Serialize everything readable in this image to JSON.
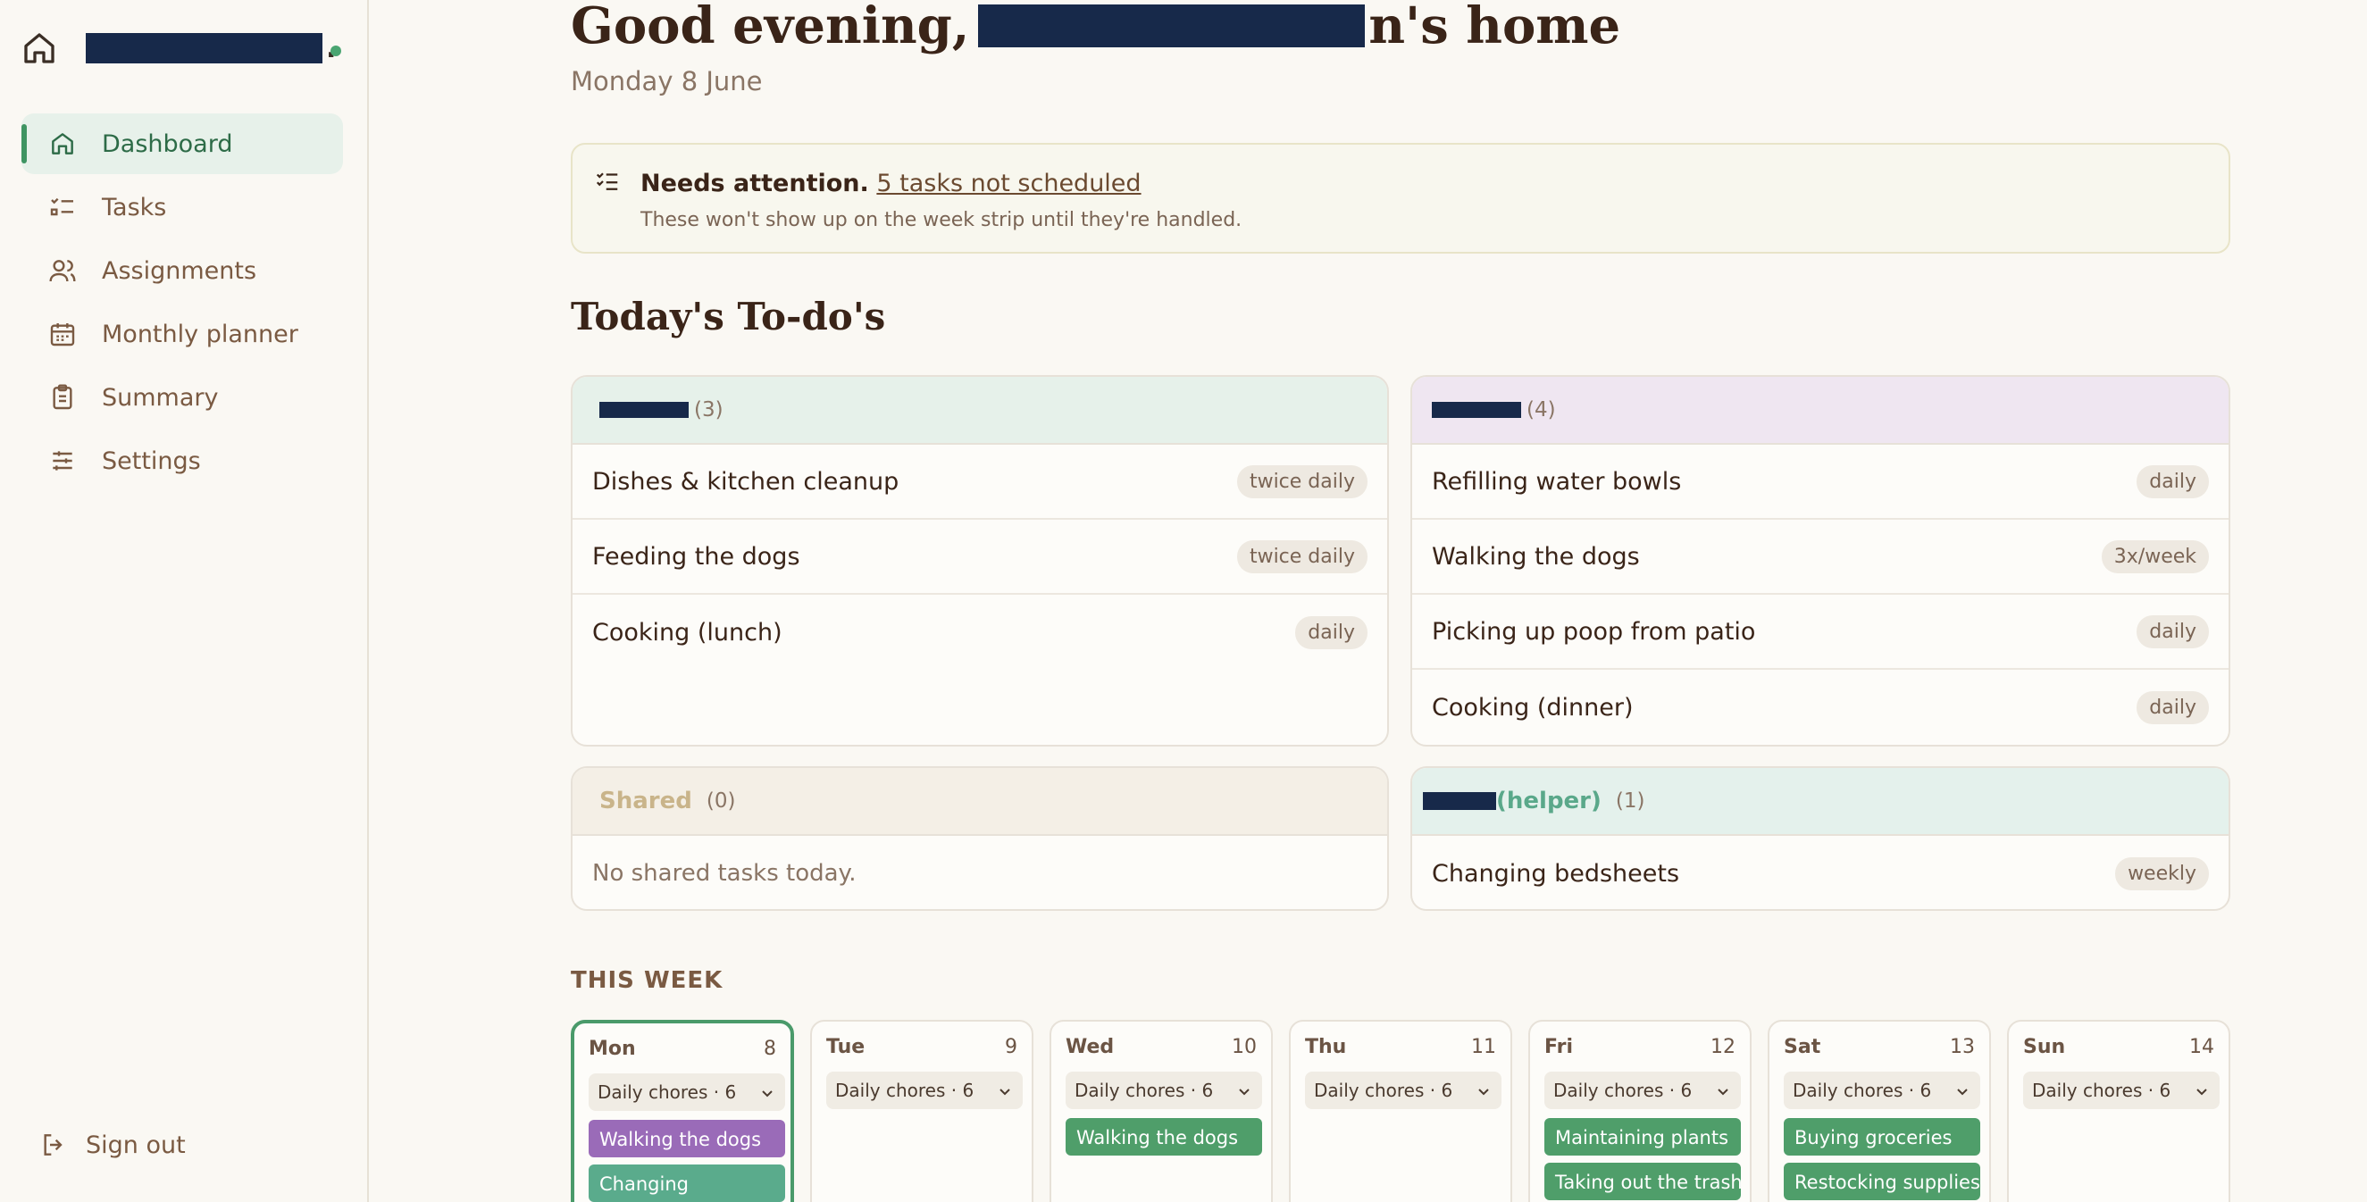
{
  "sidebar": {
    "brand_suffix": ".",
    "nav": [
      {
        "label": "Dashboard",
        "icon": "home-icon",
        "active": true
      },
      {
        "label": "Tasks",
        "icon": "list-check-icon"
      },
      {
        "label": "Assignments",
        "icon": "users-icon"
      },
      {
        "label": "Monthly planner",
        "icon": "calendar-icon"
      },
      {
        "label": "Summary",
        "icon": "clipboard-icon"
      },
      {
        "label": "Settings",
        "icon": "sliders-icon"
      }
    ],
    "sign_out": "Sign out"
  },
  "header": {
    "greeting_prefix": "Good evening,",
    "greeting_suffix": "n's home",
    "date": "Monday 8 June"
  },
  "attention": {
    "title": "Needs attention.",
    "link": "5 tasks not scheduled",
    "note": "These won't show up on the week strip until they're handled."
  },
  "todos": {
    "title": "Today's To-do's",
    "cards": [
      {
        "count": "(3)",
        "color": "#e6f1ea",
        "rows": [
          {
            "task": "Dishes & kitchen cleanup",
            "freq": "twice daily"
          },
          {
            "task": "Feeding the dogs",
            "freq": "twice daily"
          },
          {
            "task": "Cooking (lunch)",
            "freq": "daily"
          }
        ]
      },
      {
        "count": "(4)",
        "color": "#efe6f1",
        "rows": [
          {
            "task": "Refilling water bowls",
            "freq": "daily"
          },
          {
            "task": "Walking the dogs",
            "freq": "3x/week"
          },
          {
            "task": "Picking up poop from patio",
            "freq": "daily"
          },
          {
            "task": "Cooking (dinner)",
            "freq": "daily"
          }
        ]
      },
      {
        "name": "Shared",
        "count": "(0)",
        "color": "#f4efe6",
        "empty": "No shared tasks today."
      },
      {
        "name": "(helper)",
        "count": "(1)",
        "color": "#e4f1ec",
        "rows": [
          {
            "task": "Changing bedsheets",
            "freq": "weekly"
          }
        ]
      }
    ]
  },
  "week": {
    "label": "THIS WEEK",
    "days": [
      {
        "name": "Mon",
        "num": "8",
        "chores": "Daily chores · 6",
        "tags": [
          "Walking the dogs",
          "Changing"
        ]
      },
      {
        "name": "Tue",
        "num": "9",
        "chores": "Daily chores · 6",
        "tags": []
      },
      {
        "name": "Wed",
        "num": "10",
        "chores": "Daily chores · 6",
        "tags": [
          "Walking the dogs"
        ]
      },
      {
        "name": "Thu",
        "num": "11",
        "chores": "Daily chores · 6",
        "tags": []
      },
      {
        "name": "Fri",
        "num": "12",
        "chores": "Daily chores · 6",
        "tags": [
          "Maintaining plants",
          "Taking out the trash"
        ]
      },
      {
        "name": "Sat",
        "num": "13",
        "chores": "Daily chores · 6",
        "tags": [
          "Buying groceries",
          "Restocking supplies"
        ]
      },
      {
        "name": "Sun",
        "num": "14",
        "chores": "Daily chores · 6",
        "tags": []
      }
    ]
  }
}
